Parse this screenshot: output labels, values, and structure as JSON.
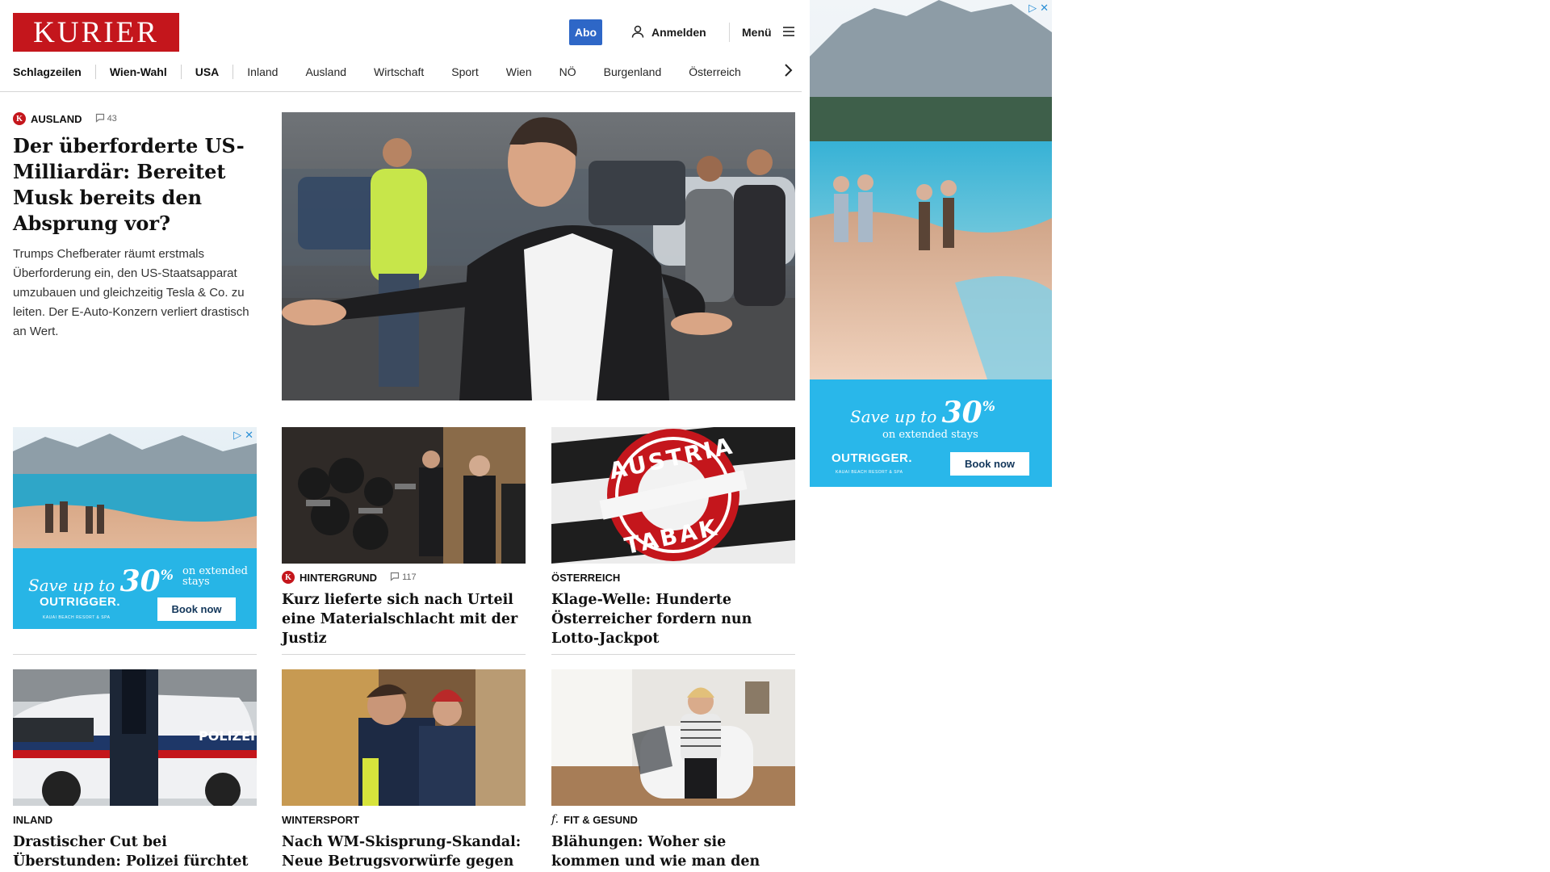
{
  "header": {
    "logo": "KURIER",
    "abo_label": "Abo",
    "login_label": "Anmelden",
    "menu_label": "Menü"
  },
  "nav": {
    "items": [
      {
        "label": "Schlagzeilen",
        "bold": true
      },
      {
        "label": "Wien-Wahl",
        "bold": true
      },
      {
        "label": "USA",
        "bold": true
      },
      {
        "label": "Inland",
        "bold": false
      },
      {
        "label": "Ausland",
        "bold": false
      },
      {
        "label": "Wirtschaft",
        "bold": false
      },
      {
        "label": "Sport",
        "bold": false
      },
      {
        "label": "Wien",
        "bold": false
      },
      {
        "label": "NÖ",
        "bold": false
      },
      {
        "label": "Burgenland",
        "bold": false
      },
      {
        "label": "Österreich",
        "bold": false
      }
    ],
    "next_icon": "chevron-right-icon"
  },
  "lead": {
    "section": "AUSLAND",
    "badge": "K",
    "comments": "43",
    "title": "Der überforderte US-Milliardär: Bereitet Musk bereits den Absprung vor?",
    "teaser": "Trumps Chefberater räumt erstmals Überforderung ein, den US-Staatsapparat umzubauen und gleichzeitig Tesla & Co. zu leiten. Der E-Auto-Konzern verliert drastisch an Wert."
  },
  "cards": [
    {
      "section": "HINTERGRUND",
      "badge": "K",
      "comments": "117",
      "title": "Kurz lieferte sich nach Urteil eine Materialschlacht mit der Justiz"
    },
    {
      "section": "ÖSTERREICH",
      "title": "Klage-Welle: Hunderte Österreicher fordern nun Lotto-Jackpot",
      "image_text_top": "AUSTRIA",
      "image_text_bottom": "TABAK"
    },
    {
      "section": "INLAND",
      "title": "Drastischer Cut bei Überstunden: Polizei fürchtet große Sparwelle",
      "image_text": "POLIZEI"
    },
    {
      "section": "WINTERSPORT",
      "title": "Nach WM-Skisprung-Skandal: Neue Betrugsvorwürfe gegen Norweger"
    },
    {
      "section": "FIT & GESUND",
      "badge": "f.",
      "title": "Blähungen: Woher sie kommen und wie man den Blähbauch los wird"
    }
  ],
  "ads": {
    "save_prefix": "Save up to",
    "save_value": "30",
    "save_unit": "%",
    "subline": "on extended stays",
    "brand": "OUTRIGGER.",
    "brand_sub": "KAUAI BEACH RESORT & SPA",
    "cta": "Book now",
    "choices_icon": "ad-choices-icon",
    "close_icon": "close-icon"
  },
  "colors": {
    "brand_red": "#c4161c",
    "abo_blue": "#2e67c7",
    "ad_sky": "#2fb9ea"
  }
}
